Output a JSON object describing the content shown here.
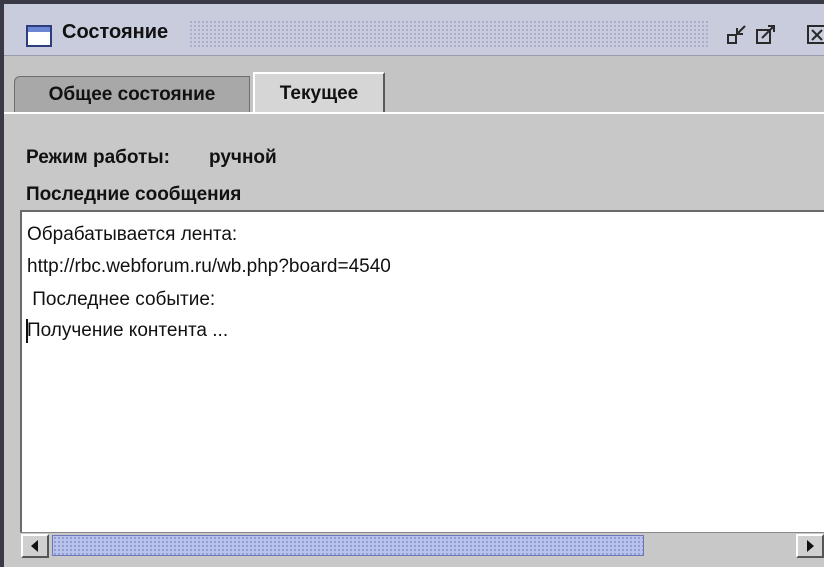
{
  "window": {
    "title": "Состояние",
    "icon": "window-icon",
    "buttons": [
      {
        "name": "minimize",
        "icon": "minimize-icon"
      },
      {
        "name": "maximize",
        "icon": "maximize-icon"
      },
      {
        "name": "close",
        "icon": "close-icon"
      }
    ]
  },
  "tabs": [
    {
      "label": "Общее состояние",
      "selected": false
    },
    {
      "label": "Текущее",
      "selected": true
    }
  ],
  "status": {
    "mode_label": "Режим работы:",
    "mode_value": "ручной",
    "messages_label": "Последние сообщения"
  },
  "log": {
    "lines": [
      "Обрабатывается лента:",
      "http://rbc.webforum.ru/wb.php?board=4540",
      " Последнее событие:",
      "Получение контента ..."
    ]
  },
  "colors": {
    "title_bar": "#c8ccdc",
    "scroll_thumb": "#b8c2ea",
    "panel": "#c8c8c8"
  }
}
